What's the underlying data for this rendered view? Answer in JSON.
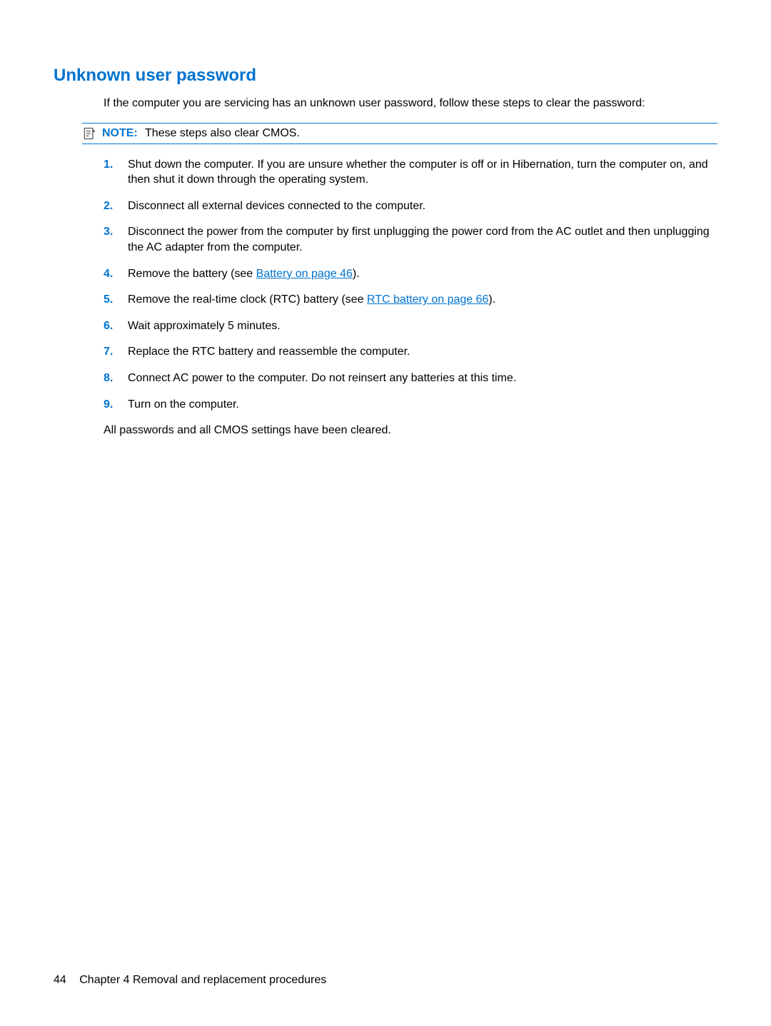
{
  "heading": "Unknown user password",
  "intro": "If the computer you are servicing has an unknown user password, follow these steps to clear the password:",
  "note": {
    "label": "NOTE:",
    "text": "These steps also clear CMOS."
  },
  "steps": [
    {
      "num": "1.",
      "text": "Shut down the computer. If you are unsure whether the computer is off or in Hibernation, turn the computer on, and then shut it down through the operating system."
    },
    {
      "num": "2.",
      "text": "Disconnect all external devices connected to the computer."
    },
    {
      "num": "3.",
      "text": "Disconnect the power from the computer by first unplugging the power cord from the AC outlet and then unplugging the AC adapter from the computer."
    },
    {
      "num": "4.",
      "prefix": "Remove the battery (see ",
      "link": "Battery on page 46",
      "suffix": ")."
    },
    {
      "num": "5.",
      "prefix": "Remove the real-time clock (RTC) battery (see ",
      "link": "RTC battery on page 66",
      "suffix": ")."
    },
    {
      "num": "6.",
      "text": "Wait approximately 5 minutes."
    },
    {
      "num": "7.",
      "text": "Replace the RTC battery and reassemble the computer."
    },
    {
      "num": "8.",
      "text": "Connect AC power to the computer. Do not reinsert any batteries at this time."
    },
    {
      "num": "9.",
      "text": "Turn on the computer."
    }
  ],
  "closing": "All passwords and all CMOS settings have been cleared.",
  "footer": {
    "pageNum": "44",
    "chapter": "Chapter 4   Removal and replacement procedures"
  }
}
